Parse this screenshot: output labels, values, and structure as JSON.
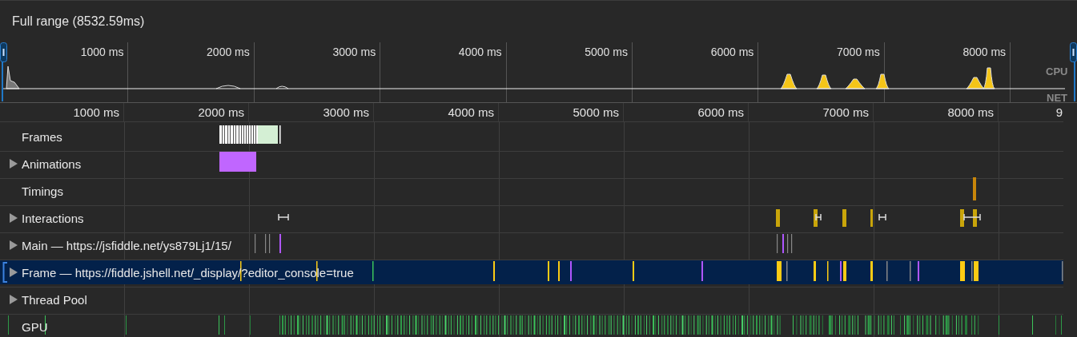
{
  "title": "Full range (8532.59ms)",
  "overview": {
    "ticks": [
      "1000 ms",
      "2000 ms",
      "3000 ms",
      "4000 ms",
      "5000 ms",
      "6000 ms",
      "7000 ms",
      "8000 ms"
    ],
    "cpu_label": "CPU",
    "net_label": "NET"
  },
  "ruler": {
    "ticks": [
      "1000 ms",
      "2000 ms",
      "3000 ms",
      "4000 ms",
      "5000 ms",
      "6000 ms",
      "7000 ms",
      "8000 ms",
      "9"
    ]
  },
  "tracks": [
    {
      "label": "Frames",
      "kind": "frames",
      "expandable": false,
      "selected": false
    },
    {
      "label": "Animations",
      "kind": "animations",
      "expandable": true,
      "selected": false
    },
    {
      "label": "Timings",
      "kind": "timings",
      "expandable": false,
      "selected": false
    },
    {
      "label": "Interactions",
      "kind": "interactions",
      "expandable": true,
      "selected": false
    },
    {
      "label": "Main — https://jsfiddle.net/ys879Lj1/15/",
      "kind": "main",
      "expandable": true,
      "selected": false
    },
    {
      "label": "Frame — https://fiddle.jshell.net/_display/?editor_console=true",
      "kind": "frame",
      "expandable": true,
      "selected": true
    },
    {
      "label": "Thread Pool",
      "kind": "pool",
      "expandable": true,
      "selected": false
    },
    {
      "label": "GPU",
      "kind": "gpu",
      "expandable": false,
      "selected": false
    }
  ]
}
